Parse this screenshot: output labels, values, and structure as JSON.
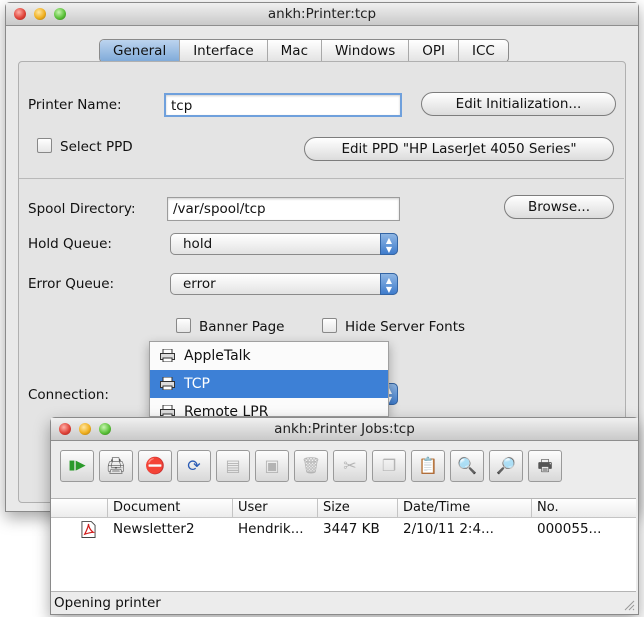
{
  "main_window": {
    "title": "ankh:Printer:tcp",
    "tabs": [
      "General",
      "Interface",
      "Mac",
      "Windows",
      "OPI",
      "ICC"
    ],
    "printer_name_label": "Printer Name:",
    "printer_name_value": "tcp",
    "edit_init_button": "Edit Initialization...",
    "select_ppd_label": "Select PPD",
    "edit_ppd_button": "Edit PPD \"HP LaserJet 4050 Series\"",
    "spool_dir_label": "Spool Directory:",
    "spool_dir_value": "/var/spool/tcp",
    "browse_button": "Browse...",
    "hold_queue_label": "Hold Queue:",
    "hold_queue_value": "hold",
    "error_queue_label": "Error Queue:",
    "error_queue_value": "error",
    "banner_page_label": "Banner Page",
    "hide_server_fonts_label": "Hide Server Fonts",
    "connection_label": "Connection:"
  },
  "connection_menu": {
    "items": [
      "AppleTalk",
      "TCP",
      "Remote LPR"
    ],
    "selected": "TCP"
  },
  "jobs_window": {
    "title": "ankh:Printer Jobs:tcp",
    "toolbar_icons": [
      "resume-icon",
      "hold-icon",
      "stop-icon",
      "refresh-icon",
      "document-icon",
      "document-info-icon",
      "trash-icon",
      "cut-icon",
      "copy-icon",
      "paste-icon",
      "search-icon",
      "search-disabled-icon",
      "printer-icon"
    ],
    "columns": [
      "Document",
      "User",
      "Size",
      "Date/Time",
      "No."
    ],
    "rows": [
      {
        "document": "Newsletter2",
        "user": "Hendrik...",
        "size": "3447 KB",
        "datetime": "2/10/11 2:4...",
        "no": "000055..."
      }
    ],
    "status": "Opening printer"
  },
  "colors": {
    "selection": "#3d80d6",
    "tab_active": "#8fb4e0"
  }
}
